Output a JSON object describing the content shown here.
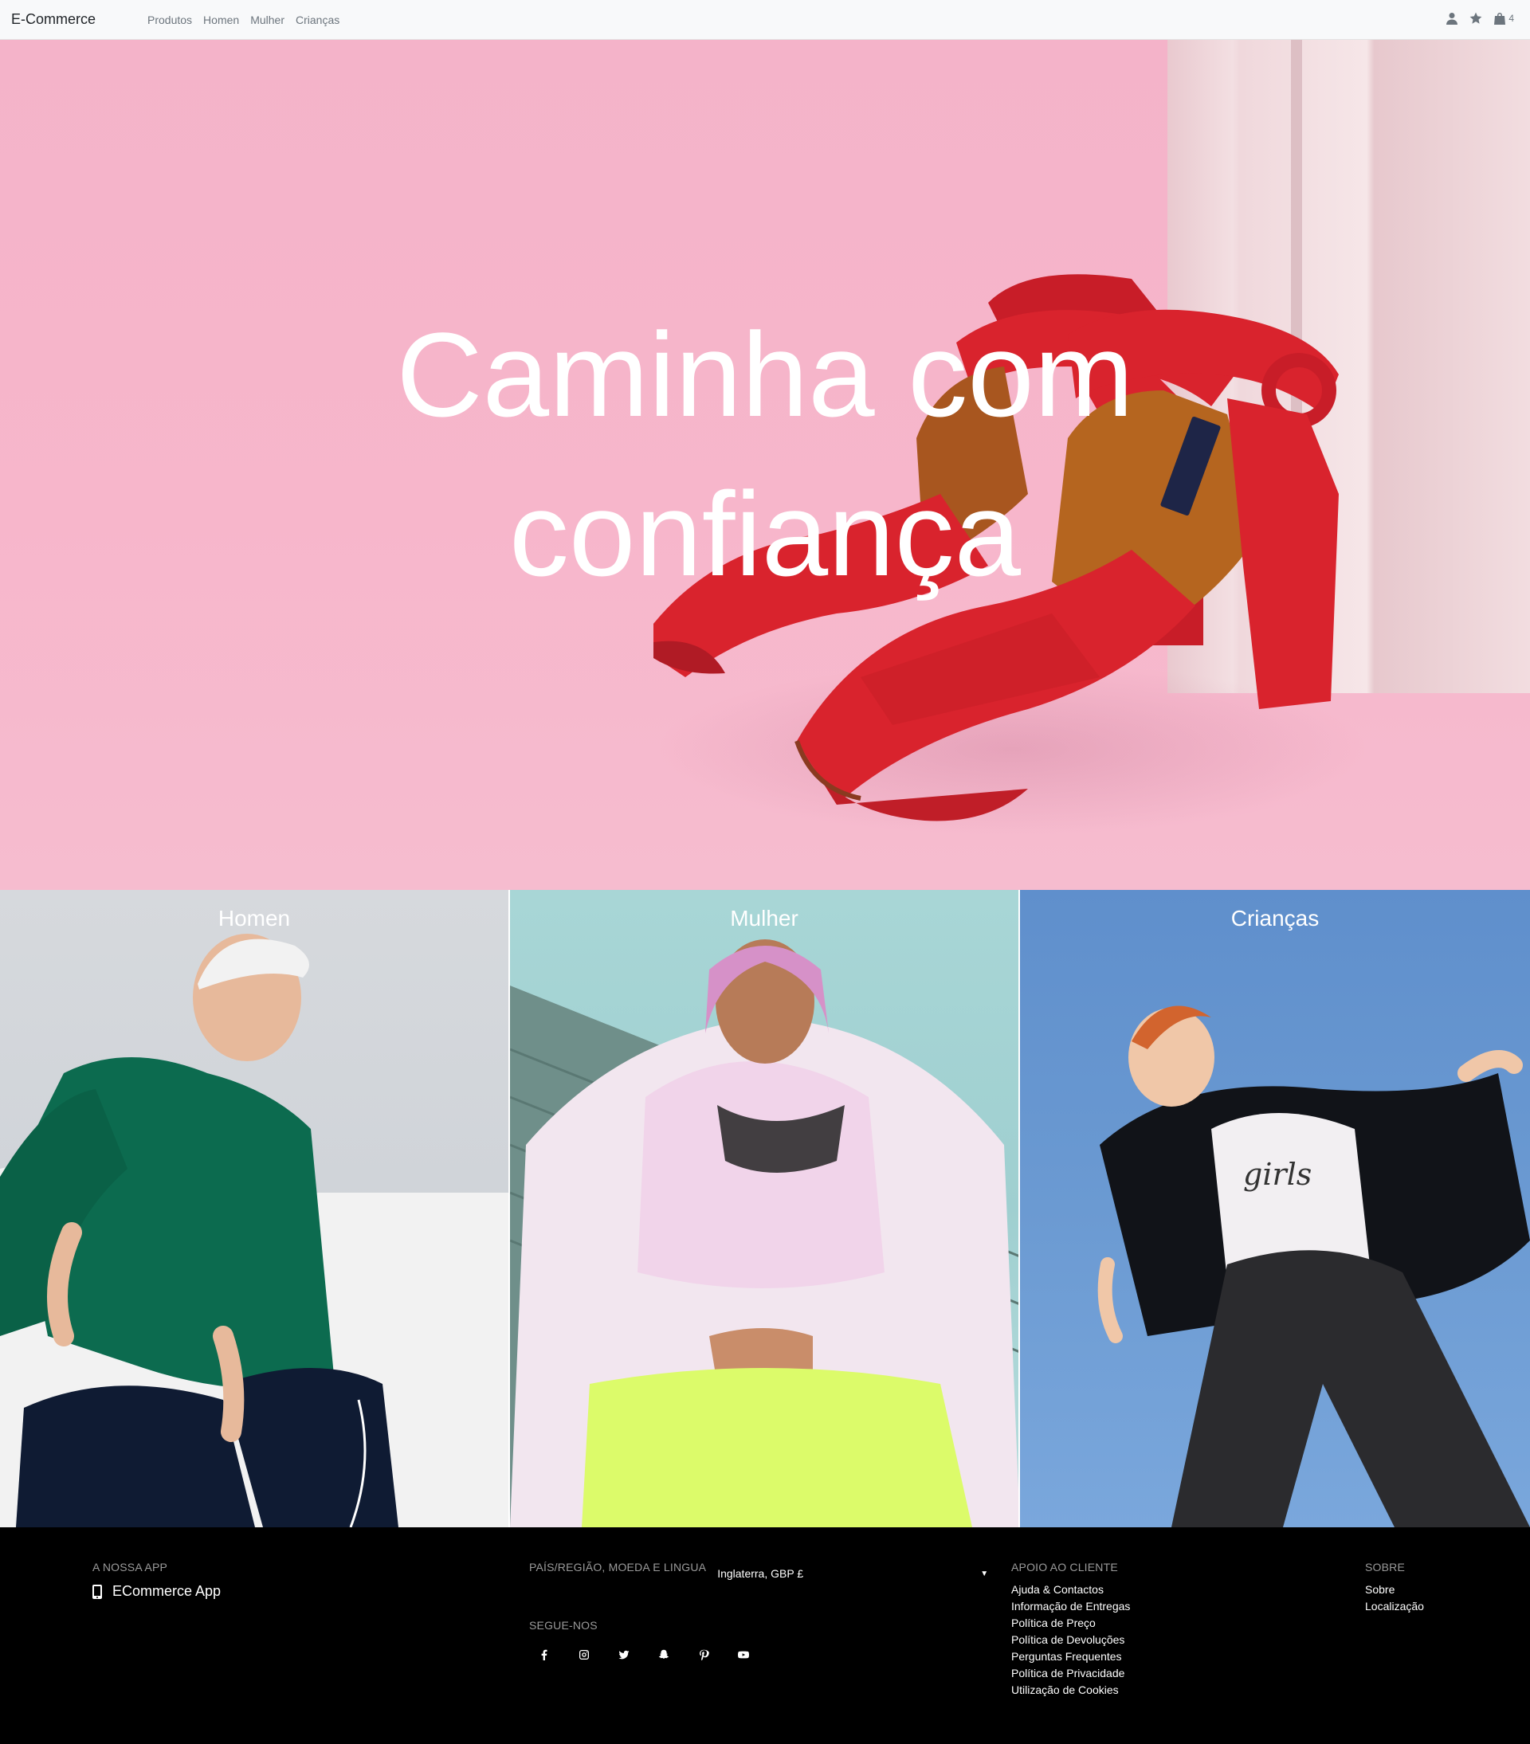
{
  "navbar": {
    "brand": "E-Commerce",
    "links": [
      "Produtos",
      "Homen",
      "Mulher",
      "Crianças"
    ],
    "icons": [
      "user-icon",
      "star-icon",
      "bag-icon"
    ],
    "cart_count": "4"
  },
  "hero": {
    "title_line1": "Caminha com",
    "title_line2": "confiança",
    "background_color": "#f6b7cb",
    "shoe_color": "#d9232d"
  },
  "categories": [
    {
      "label": "Homen"
    },
    {
      "label": "Mulher"
    },
    {
      "label": "Crianças"
    }
  ],
  "footer": {
    "app": {
      "heading": "A NOSSA APP",
      "link": "ECommerce App",
      "icon": "phone-icon"
    },
    "region": {
      "heading": "PAÍS/REGIÃO, MOEDA E LINGUA",
      "selected": "Inglaterra, GBP £"
    },
    "follow": {
      "heading": "SEGUE-NOS",
      "icons": [
        "facebook-icon",
        "instagram-icon",
        "twitter-icon",
        "snapchat-icon",
        "pinterest-icon",
        "youtube-icon"
      ]
    },
    "support": {
      "heading": "APOIO AO CLIENTE",
      "links": [
        "Ajuda & Contactos",
        "Informação de Entregas",
        "Política de Preço",
        "Política de Devoluções",
        "Perguntas Frequentes",
        "Política de Privacidade",
        "Utilização de Cookies"
      ]
    },
    "about": {
      "heading": "SOBRE",
      "links": [
        "Sobre",
        "Localização"
      ]
    }
  }
}
